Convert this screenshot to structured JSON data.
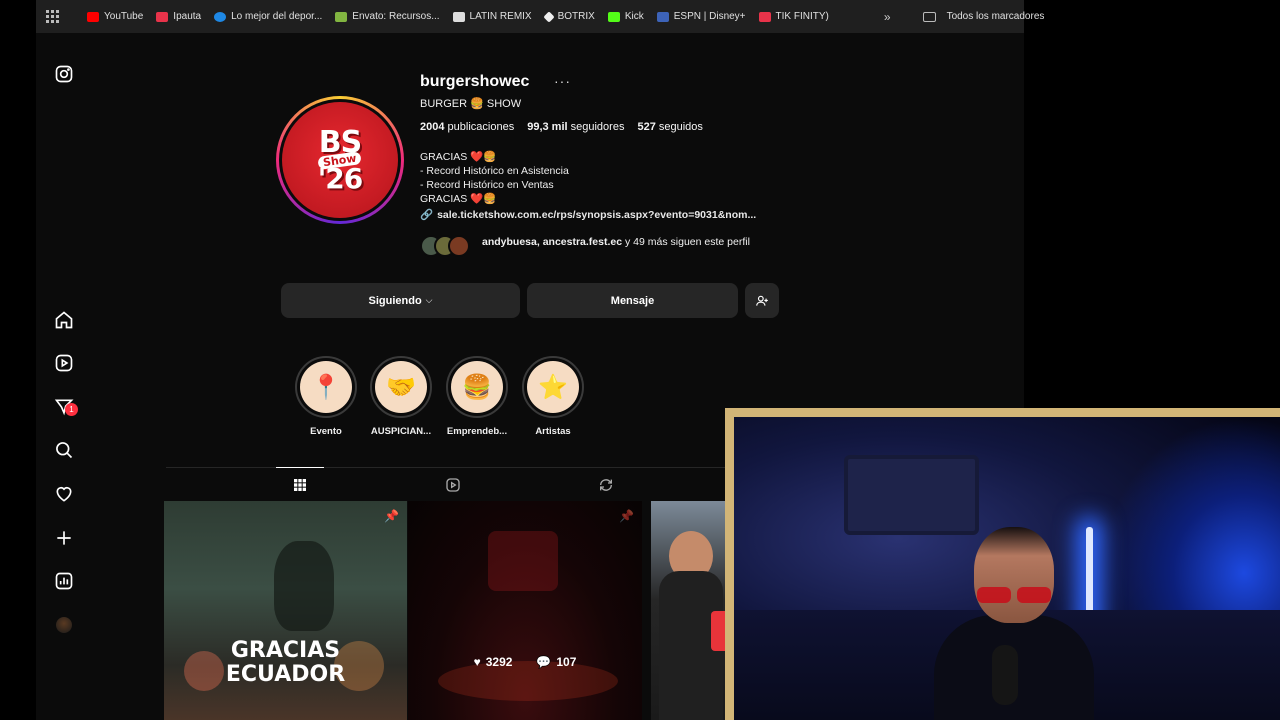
{
  "bookmarks": {
    "items": [
      {
        "label": "YouTube",
        "color": "#ff0000"
      },
      {
        "label": "Ipauta",
        "color": "#e8334a"
      },
      {
        "label": "Lo mejor del depor...",
        "color": "#1e88e5"
      },
      {
        "label": "Envato: Recursos...",
        "color": "#82b541"
      },
      {
        "label": "LATIN REMIX",
        "color": "#dddddd"
      },
      {
        "label": "BOTRIX",
        "color": "#eeeeee"
      },
      {
        "label": "Kick",
        "color": "#53fc18"
      },
      {
        "label": "ESPN | Disney+",
        "color": "#3d63b8"
      },
      {
        "label": "TIK FINITY)",
        "color": "#e8334a"
      }
    ],
    "more": "»",
    "all_label": "Todos los marcadores"
  },
  "nav": {
    "notification_count": "1"
  },
  "profile": {
    "username": "burgershowec",
    "options": "···",
    "full_name": "BURGER 🍔 SHOW",
    "logo_top": "BS",
    "logo_mid": "Show",
    "logo_bottom": "'26",
    "stats": {
      "posts_value": "2004",
      "posts_label": "publicaciones",
      "followers_value": "99,3 mil",
      "followers_label": "seguidores",
      "following_value": "527",
      "following_label": "seguidos"
    },
    "bio": [
      "GRACIAS ❤️🍔",
      "- Record Histórico en Asistencia",
      "- Record Histórico en Ventas",
      "GRACIAS ❤️🍔"
    ],
    "link": "sale.ticketshow.com.ec/rps/synopsis.aspx?evento=9031&nom...",
    "followed_by_names": "andybuesa, ancestra.fest.ec",
    "followed_by_rest": "y 49 más siguen este perfil"
  },
  "buttons": {
    "following": "Siguiendo",
    "message": "Mensaje"
  },
  "highlights": [
    {
      "label": "Evento",
      "glyph": "📍"
    },
    {
      "label": "AUSPICIAN...",
      "glyph": "🤝"
    },
    {
      "label": "Emprendeb...",
      "glyph": "🍔"
    },
    {
      "label": "Artistas",
      "glyph": "⭐"
    }
  ],
  "posts": {
    "first_text_line1": "GRACIAS",
    "first_text_line2": "ECUADOR",
    "likes": "3292",
    "comments": "107"
  },
  "icons": {
    "nav": [
      "instagram-logo-icon",
      "home-icon",
      "reels-icon",
      "messenger-icon",
      "search-icon",
      "heart-icon",
      "plus-icon",
      "dashboard-icon",
      "profile-avatar"
    ],
    "tabs": [
      "grid-icon",
      "reels-tab-icon",
      "tagged-icon"
    ]
  },
  "colors": {
    "accent_red": "#e6282f",
    "webcam_border": "#d2b577",
    "badge": "#ff3040"
  }
}
